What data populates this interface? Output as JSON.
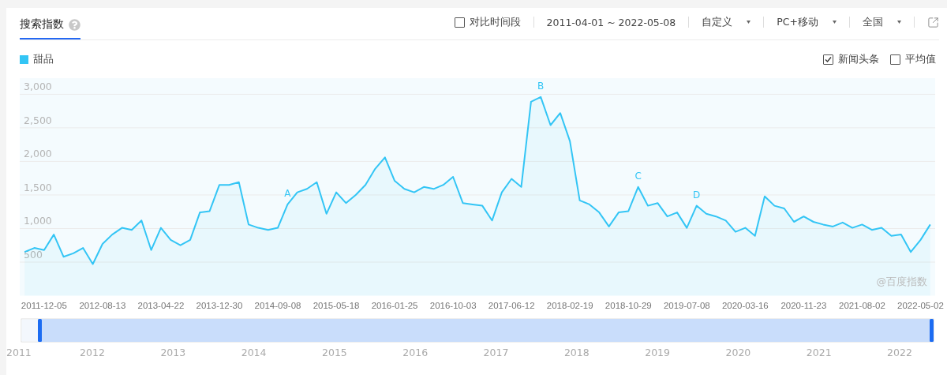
{
  "tabs": [
    {
      "label": "搜索指数",
      "selected": true
    }
  ],
  "toolbar": {
    "compare": {
      "label": "对比时间段",
      "checked": false
    },
    "date_range": "2011-04-01 ~ 2022-05-08",
    "dropdowns": [
      {
        "label": "自定义"
      },
      {
        "label": "PC+移动"
      },
      {
        "label": "全国"
      }
    ]
  },
  "options": [
    {
      "label": "新闻头条",
      "checked": true
    },
    {
      "label": "平均值",
      "checked": false
    }
  ],
  "chart": {
    "watermark": "@百度指数",
    "chart_data": {
      "type": "area",
      "grid": true,
      "ylim": [
        0,
        3240
      ],
      "yticks": [
        {
          "value": 500,
          "label": "500"
        },
        {
          "value": 1000,
          "label": "1,000"
        },
        {
          "value": 1500,
          "label": "1,500"
        },
        {
          "value": 2000,
          "label": "2,000"
        },
        {
          "value": 2500,
          "label": "2,500"
        },
        {
          "value": 3000,
          "label": "3,000"
        }
      ],
      "categories": [
        null,
        null,
        "2011-12-05",
        null,
        null,
        null,
        null,
        null,
        "2012-08-13",
        null,
        null,
        null,
        null,
        null,
        "2013-04-22",
        null,
        null,
        null,
        null,
        null,
        "2013-12-30",
        null,
        null,
        null,
        null,
        null,
        "2014-09-08",
        null,
        null,
        null,
        null,
        null,
        "2015-05-18",
        null,
        null,
        null,
        null,
        null,
        "2016-01-25",
        null,
        null,
        null,
        null,
        null,
        "2016-10-03",
        null,
        null,
        null,
        null,
        null,
        "2017-06-12",
        null,
        null,
        null,
        null,
        null,
        "2018-02-19",
        null,
        null,
        null,
        null,
        null,
        "2018-10-29",
        null,
        null,
        null,
        null,
        null,
        "2019-07-08",
        null,
        null,
        null,
        null,
        null,
        "2020-03-16",
        null,
        null,
        null,
        null,
        null,
        "2020-11-23",
        null,
        null,
        null,
        null,
        null,
        "2021-08-02",
        null,
        null,
        null,
        null,
        null,
        "2022-05-02",
        null
      ],
      "series": [
        {
          "name": "甜品",
          "color": "#33c5f5",
          "values": [
            650,
            710,
            680,
            910,
            580,
            630,
            710,
            470,
            770,
            910,
            1010,
            980,
            1120,
            680,
            1010,
            830,
            750,
            830,
            1240,
            1260,
            1650,
            1650,
            1690,
            1060,
            1010,
            980,
            1010,
            1360,
            1540,
            1590,
            1690,
            1220,
            1540,
            1380,
            1500,
            1650,
            1890,
            2060,
            1710,
            1590,
            1540,
            1620,
            1590,
            1650,
            1770,
            1380,
            1360,
            1340,
            1120,
            1540,
            1740,
            1620,
            2890,
            2960,
            2540,
            2720,
            2300,
            1420,
            1360,
            1240,
            1030,
            1240,
            1260,
            1620,
            1340,
            1380,
            1180,
            1240,
            1010,
            1340,
            1220,
            1180,
            1120,
            950,
            1010,
            890,
            1480,
            1340,
            1300,
            1100,
            1180,
            1100,
            1060,
            1030,
            1090,
            1010,
            1060,
            980,
            1010,
            890,
            910,
            650,
            830,
            1060
          ]
        }
      ],
      "value_labels": [
        null,
        null,
        null,
        null,
        null,
        null,
        null,
        null,
        null,
        null,
        null,
        null,
        null,
        null,
        null,
        null,
        null,
        null,
        null,
        null,
        null,
        null,
        null,
        null,
        null,
        null,
        null,
        "A",
        null,
        null,
        null,
        null,
        null,
        null,
        null,
        null,
        null,
        null,
        null,
        null,
        null,
        null,
        null,
        null,
        null,
        null,
        null,
        null,
        null,
        null,
        null,
        null,
        null,
        "B",
        null,
        null,
        null,
        null,
        null,
        null,
        null,
        null,
        null,
        "C",
        null,
        null,
        null,
        null,
        null,
        "D",
        null,
        null,
        null,
        null,
        null,
        null,
        null,
        null,
        null,
        null,
        null,
        null,
        null,
        null,
        null,
        null,
        null,
        null,
        null,
        null,
        null,
        null,
        null,
        null
      ]
    }
  },
  "navigator": {
    "years": [
      "2011",
      "2012",
      "2013",
      "2014",
      "2015",
      "2016",
      "2017",
      "2018",
      "2019",
      "2020",
      "2021",
      "2022"
    ]
  }
}
